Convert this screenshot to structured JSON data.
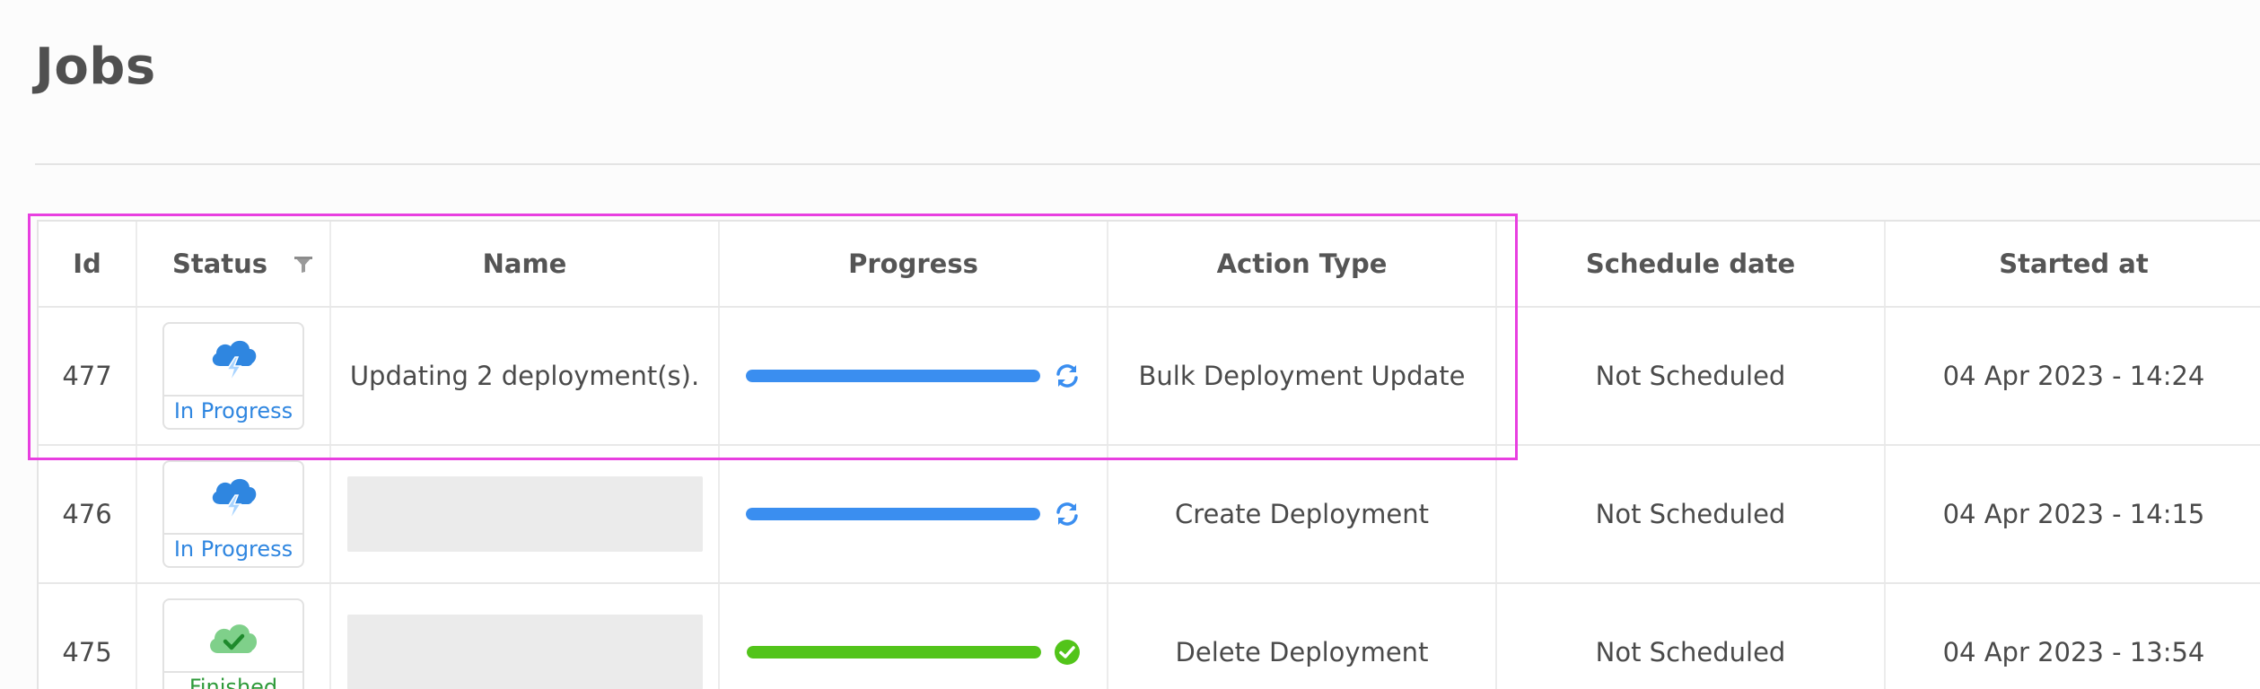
{
  "page": {
    "title": "Jobs"
  },
  "table": {
    "columns": {
      "id": "Id",
      "status": "Status",
      "name": "Name",
      "progress": "Progress",
      "action_type": "Action Type",
      "schedule_date": "Schedule date",
      "started_at": "Started at"
    },
    "rows": [
      {
        "id": "477",
        "status": "In Progress",
        "status_icon": "cloud-lightning-icon",
        "name": "Updating 2 deployment(s).",
        "progress_fraction": 1.0,
        "progress_color": "#3a8ef0",
        "progress_icon": "refresh-icon",
        "action_type": "Bulk Deployment Update",
        "schedule_date": "Not Scheduled",
        "started_at": "04 Apr 2023 - 14:24"
      },
      {
        "id": "476",
        "status": "In Progress",
        "status_icon": "cloud-lightning-icon",
        "name": "",
        "progress_fraction": 1.0,
        "progress_color": "#3a8ef0",
        "progress_icon": "refresh-icon",
        "action_type": "Create Deployment",
        "schedule_date": "Not Scheduled",
        "started_at": "04 Apr 2023 - 14:15"
      },
      {
        "id": "475",
        "status": "Finished",
        "status_icon": "cloud-check-icon",
        "name": "",
        "progress_fraction": 1.0,
        "progress_color": "#52c41a",
        "progress_icon": "check-circle-icon",
        "action_type": "Delete Deployment",
        "schedule_date": "Not Scheduled",
        "started_at": "04 Apr 2023 - 13:54"
      }
    ]
  },
  "colors": {
    "in_progress": "#2f86e0",
    "finished": "#2e9a3a",
    "highlight": "#e83fe0"
  }
}
